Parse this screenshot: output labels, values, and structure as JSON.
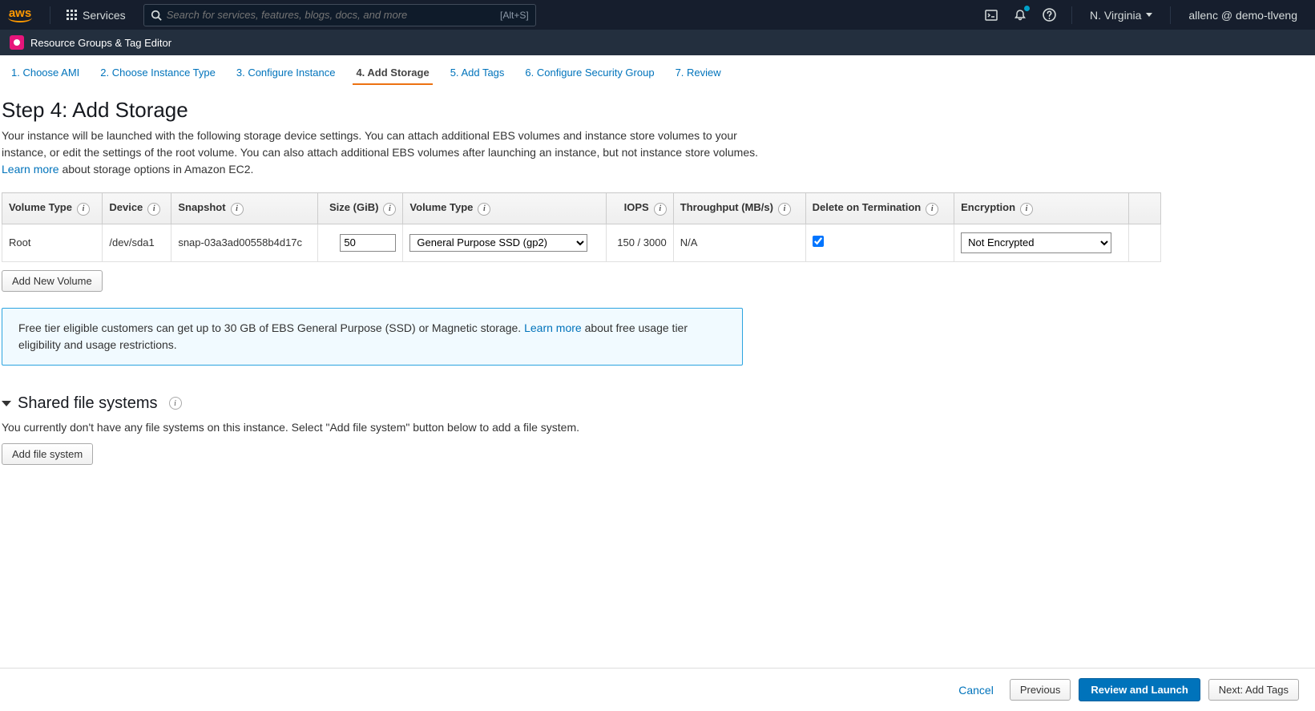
{
  "topbar": {
    "logo": "aws",
    "services_label": "Services",
    "search_placeholder": "Search for services, features, blogs, docs, and more",
    "search_kbd": "[Alt+S]",
    "region": "N. Virginia",
    "account": "allenc @ demo-tlveng"
  },
  "secondbar": {
    "label": "Resource Groups & Tag Editor"
  },
  "wizard": {
    "steps": [
      {
        "label": "1. Choose AMI"
      },
      {
        "label": "2. Choose Instance Type"
      },
      {
        "label": "3. Configure Instance"
      },
      {
        "label": "4. Add Storage"
      },
      {
        "label": "5. Add Tags"
      },
      {
        "label": "6. Configure Security Group"
      },
      {
        "label": "7. Review"
      }
    ]
  },
  "page": {
    "title": "Step 4: Add Storage",
    "desc1": "Your instance will be launched with the following storage device settings. You can attach additional EBS volumes and instance store volumes to your instance, or edit the settings of the root volume. You can also attach additional EBS volumes after launching an instance, but not instance store volumes. ",
    "learn_more": "Learn more",
    "desc2": " about storage options in Amazon EC2."
  },
  "table": {
    "headers": {
      "volume_type": "Volume Type",
      "device": "Device",
      "snapshot": "Snapshot",
      "size": "Size (GiB)",
      "volume_type2": "Volume Type",
      "iops": "IOPS",
      "throughput": "Throughput (MB/s)",
      "delete_on_term": "Delete on Termination",
      "encryption": "Encryption"
    },
    "row": {
      "volume_type": "Root",
      "device": "/dev/sda1",
      "snapshot": "snap-03a3ad00558b4d17c",
      "size": "50",
      "volume_type2": "General Purpose SSD (gp2)",
      "iops": "150 / 3000",
      "throughput": "N/A",
      "delete_on_term": true,
      "encryption": "Not Encrypted"
    },
    "add_volume": "Add New Volume"
  },
  "info": {
    "text1": "Free tier eligible customers can get up to 30 GB of EBS General Purpose (SSD) or Magnetic storage. ",
    "learn_more": "Learn more",
    "text2": " about free usage tier eligibility and usage restrictions."
  },
  "sharedfs": {
    "title": "Shared file systems",
    "text": "You currently don't have any file systems on this instance. Select \"Add file system\" button below to add a file system.",
    "add": "Add file system"
  },
  "footer": {
    "cancel": "Cancel",
    "previous": "Previous",
    "review": "Review and Launch",
    "next": "Next: Add Tags"
  }
}
